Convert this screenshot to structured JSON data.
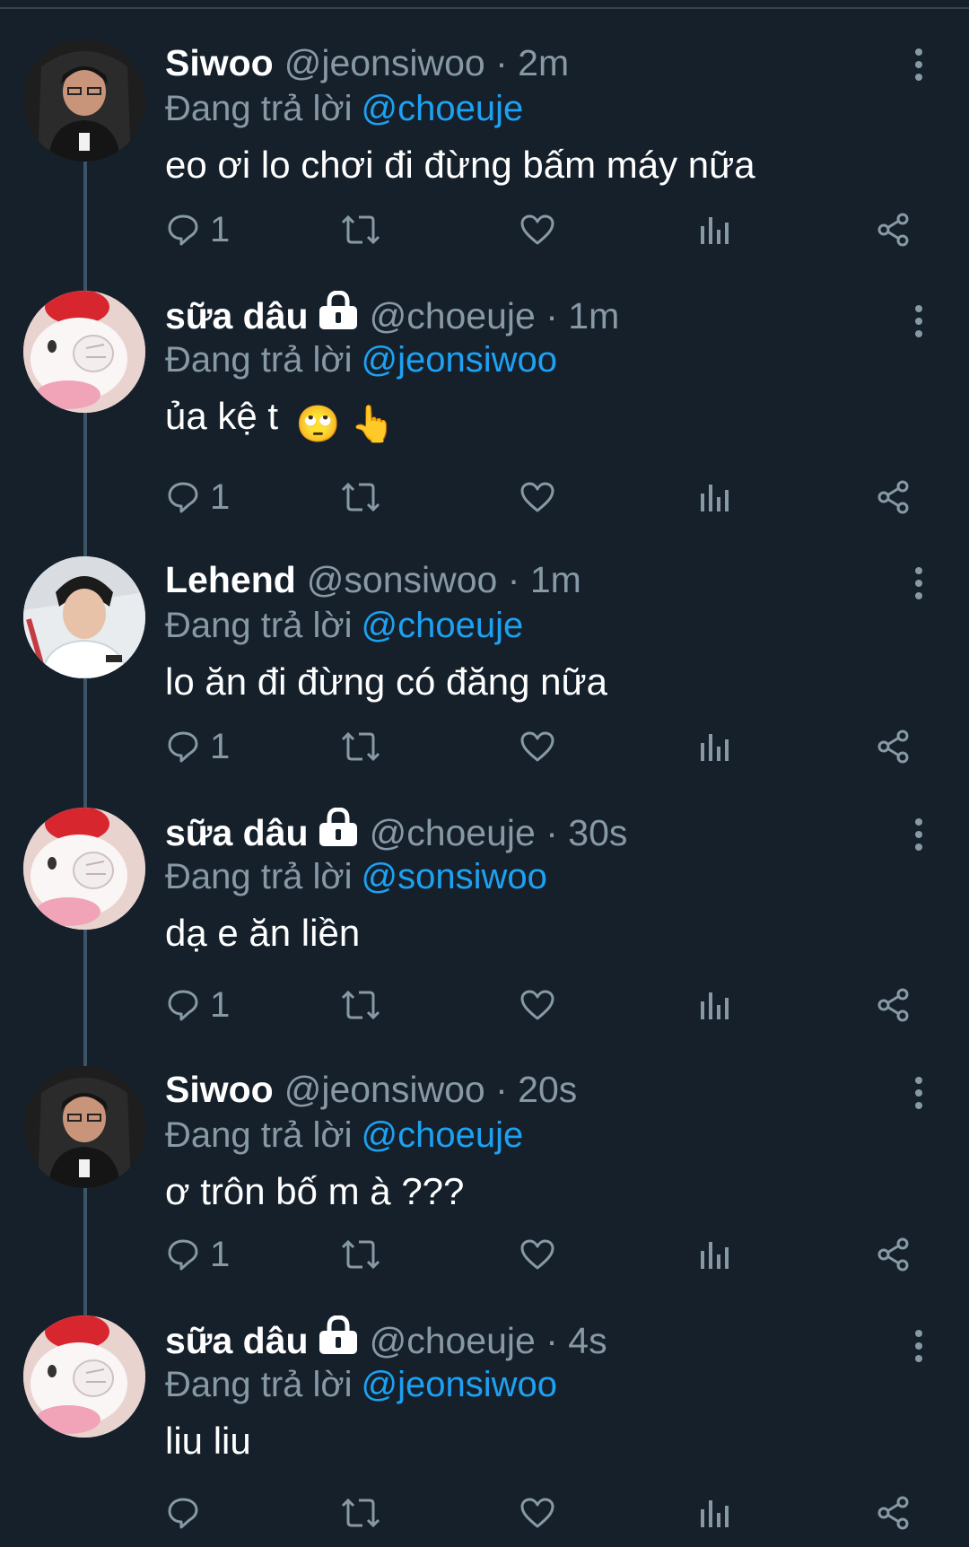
{
  "reply_prefix": "Đang trả lời",
  "tweets": [
    {
      "name": "Siwoo",
      "locked": false,
      "handle": "@jeonsiwoo",
      "dot": "·",
      "time": "2m",
      "reply_to": "@choeuje",
      "text": "eo ơi lo chơi đi đừng bấm máy nữa",
      "emoji": "",
      "replies": "1"
    },
    {
      "name": "sữa dâu",
      "locked": true,
      "handle": "@choeuje",
      "dot": "·",
      "time": "1m",
      "reply_to": "@jeonsiwoo",
      "text": "ủa kệ t",
      "emoji": "🙄 👆",
      "replies": "1"
    },
    {
      "name": "Lehend",
      "locked": false,
      "handle": "@sonsiwoo",
      "dot": "·",
      "time": "1m",
      "reply_to": "@choeuje",
      "text": "lo ăn đi đừng có đăng nữa",
      "emoji": "",
      "replies": "1"
    },
    {
      "name": "sữa dâu",
      "locked": true,
      "handle": "@choeuje",
      "dot": "·",
      "time": "30s",
      "reply_to": "@sonsiwoo",
      "text": "dạ e ăn liền",
      "emoji": "",
      "replies": "1"
    },
    {
      "name": "Siwoo",
      "locked": false,
      "handle": "@jeonsiwoo",
      "dot": "·",
      "time": "20s",
      "reply_to": "@choeuje",
      "text": "ơ trôn bố m à ???",
      "emoji": "",
      "replies": "1"
    },
    {
      "name": "sữa dâu",
      "locked": true,
      "handle": "@choeuje",
      "dot": "·",
      "time": "4s",
      "reply_to": "@jeonsiwoo",
      "text": "liu liu",
      "emoji": "",
      "replies": ""
    }
  ],
  "icons": {
    "reply": "reply-icon",
    "retweet": "retweet-icon",
    "like": "heart-icon",
    "views": "analytics-icon",
    "share": "share-icon",
    "more": "more-vertical-icon",
    "lock": "lock-icon"
  },
  "colors": {
    "background": "#15202b",
    "secondary_text": "#8899a6",
    "link": "#1da1f2",
    "thread_line": "#3d5466"
  }
}
